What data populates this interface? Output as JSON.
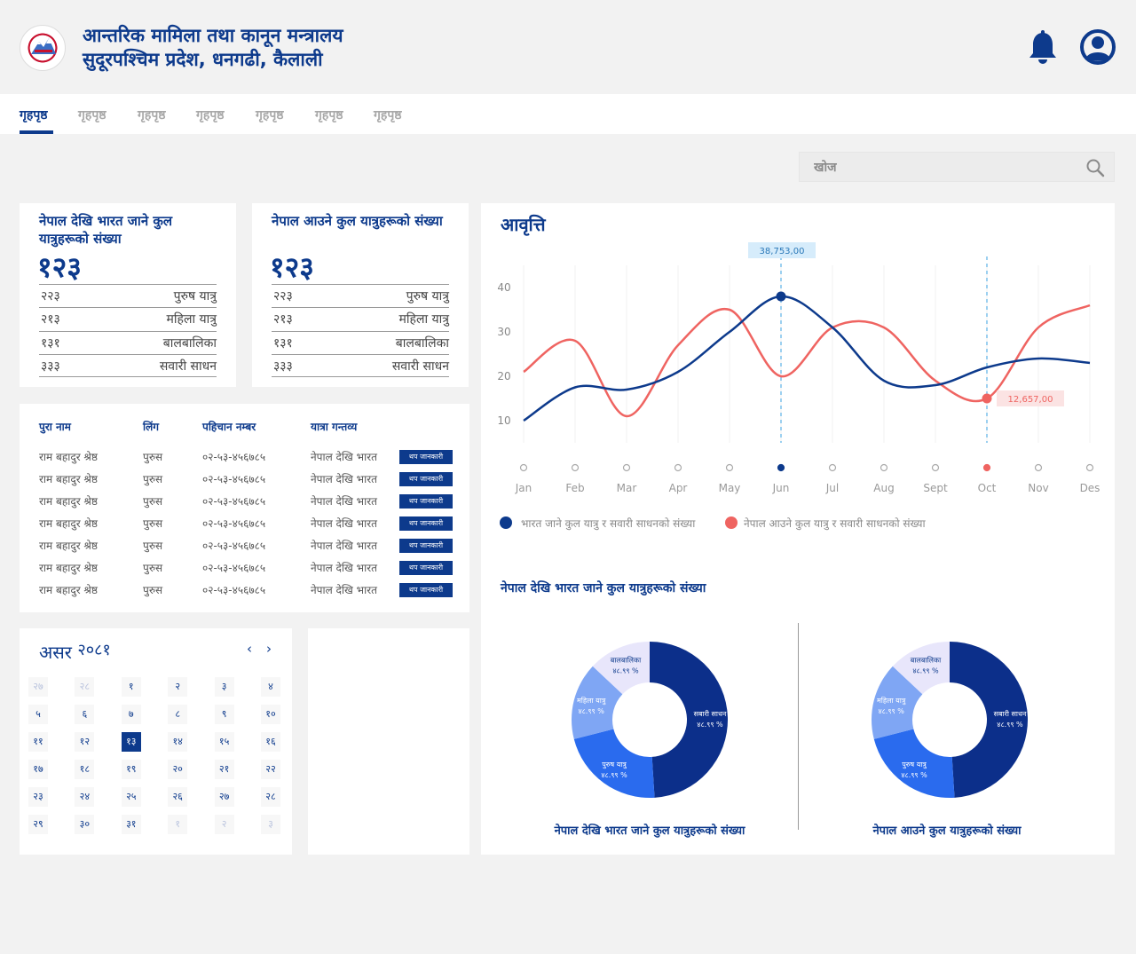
{
  "header": {
    "title_line1": "आन्तरिक मामिला तथा कानून मन्त्रालय",
    "title_line2": "सुदूरपश्चिम प्रदेश, धनगढी, कैलाली",
    "icons": [
      "bell-icon",
      "user-icon"
    ]
  },
  "nav": {
    "tabs": [
      "गृहपृष्ठ",
      "गृहपृष्ठ",
      "गृहपृष्ठ",
      "गृहपृष्ठ",
      "गृहपृष्ठ",
      "गृहपृष्ठ",
      "गृहपृष्ठ"
    ],
    "active_index": 0
  },
  "search": {
    "placeholder": "खोज"
  },
  "stat_cards": [
    {
      "title": "नेपाल देखि भारत जाने कुल यात्रुहरूको संख्या",
      "total": "१२३",
      "rows": [
        {
          "value": "२२३",
          "label": "पुरुष यात्रु"
        },
        {
          "value": "२१३",
          "label": "महिला यात्रु"
        },
        {
          "value": "१३१",
          "label": "बालबालिका"
        },
        {
          "value": "३३३",
          "label": "सवारी साधन"
        }
      ]
    },
    {
      "title": "नेपाल आउने कुल यात्रुहरूको संख्या",
      "total": "१२३",
      "rows": [
        {
          "value": "२२३",
          "label": "पुरुष यात्रु"
        },
        {
          "value": "२१३",
          "label": "महिला यात्रु"
        },
        {
          "value": "१३१",
          "label": "बालबालिका"
        },
        {
          "value": "३३३",
          "label": "सवारी साधन"
        }
      ]
    }
  ],
  "table": {
    "headers": [
      "पुरा नाम",
      "लिंग",
      "पहिचान नम्बर",
      "यात्रा गन्तव्य"
    ],
    "button_label": "थप जानकारी",
    "rows": [
      [
        "राम बहादुर श्रेष्ठ",
        "पुरुस",
        "०२-५३-४५६७८५",
        "नेपाल देखि भारत"
      ],
      [
        "राम बहादुर श्रेष्ठ",
        "पुरुस",
        "०२-५३-४५६७८५",
        "नेपाल देखि भारत"
      ],
      [
        "राम बहादुर श्रेष्ठ",
        "पुरुस",
        "०२-५३-४५६७८५",
        "नेपाल देखि भारत"
      ],
      [
        "राम बहादुर श्रेष्ठ",
        "पुरुस",
        "०२-५३-४५६७८५",
        "नेपाल देखि भारत"
      ],
      [
        "राम बहादुर श्रेष्ठ",
        "पुरुस",
        "०२-५३-४५६७८५",
        "नेपाल देखि भारत"
      ],
      [
        "राम बहादुर श्रेष्ठ",
        "पुरुस",
        "०२-५३-४५६७८५",
        "नेपाल देखि भारत"
      ],
      [
        "राम बहादुर श्रेष्ठ",
        "पुरुस",
        "०२-५३-४५६७८५",
        "नेपाल देखि भारत"
      ]
    ]
  },
  "calendar": {
    "month": "असर",
    "year": "२०८१",
    "prev": "‹",
    "next": "›",
    "selected_index": 14,
    "days": [
      {
        "d": "२७",
        "m": true
      },
      {
        "d": "२८",
        "m": true
      },
      {
        "d": "१",
        "m": false
      },
      {
        "d": "२",
        "m": false
      },
      {
        "d": "३",
        "m": false
      },
      {
        "d": "४",
        "m": false
      },
      {
        "d": "५",
        "m": false
      },
      {
        "d": "६",
        "m": false
      },
      {
        "d": "७",
        "m": false
      },
      {
        "d": "८",
        "m": false
      },
      {
        "d": "९",
        "m": false
      },
      {
        "d": "१०",
        "m": false
      },
      {
        "d": "११",
        "m": false
      },
      {
        "d": "१२",
        "m": false
      },
      {
        "d": "१३",
        "m": false
      },
      {
        "d": "१४",
        "m": false
      },
      {
        "d": "१५",
        "m": false
      },
      {
        "d": "१६",
        "m": false
      },
      {
        "d": "१७",
        "m": false
      },
      {
        "d": "१८",
        "m": false
      },
      {
        "d": "१९",
        "m": false
      },
      {
        "d": "२०",
        "m": false
      },
      {
        "d": "२१",
        "m": false
      },
      {
        "d": "२२",
        "m": false
      },
      {
        "d": "२३",
        "m": false
      },
      {
        "d": "२४",
        "m": false
      },
      {
        "d": "२५",
        "m": false
      },
      {
        "d": "२६",
        "m": false
      },
      {
        "d": "२७",
        "m": false
      },
      {
        "d": "२८",
        "m": false
      },
      {
        "d": "२९",
        "m": false
      },
      {
        "d": "३०",
        "m": false
      },
      {
        "d": "३१",
        "m": false
      },
      {
        "d": "१",
        "m": true
      },
      {
        "d": "२",
        "m": true
      },
      {
        "d": "३",
        "m": true
      }
    ]
  },
  "chart_section": {
    "title": "आवृत्ति",
    "legend": [
      "भारत जाने कुल यात्रु र सवारी साधनको संख्या",
      "नेपाल आउने कुल यात्रु र सवारी साधनको संख्या"
    ],
    "donut_section_title": "नेपाल देखि  भारत जाने कुल यात्रुहरूको संख्या",
    "donut_captions": [
      "नेपाल देखि  भारत जाने कुल यात्रुहरूको संख्या",
      "नेपाल आउने कुल यात्रुहरूको संख्या"
    ]
  },
  "colors": {
    "primary": "#0d3a8c",
    "red": "#ef6461",
    "light_blue_tag": "#d6ecfb",
    "light_red_tag": "#fbe3e3"
  },
  "chart_data": [
    {
      "type": "line",
      "x": [
        "Jan",
        "Feb",
        "Mar",
        "Apr",
        "May",
        "Jun",
        "Jul",
        "Aug",
        "Sept",
        "Oct",
        "Nov",
        "Des"
      ],
      "ylim": [
        5,
        45
      ],
      "yticks": [
        10,
        20,
        30,
        40
      ],
      "series": [
        {
          "name": "भारत जाने कुल यात्रु र सवारी साधनको संख्या",
          "color": "#0d3a8c",
          "values": [
            10,
            17.5,
            17,
            21,
            30,
            38,
            31,
            19,
            18,
            22,
            24,
            23
          ]
        },
        {
          "name": "नेपाल आउने कुल यात्रु र सवारी साधनको संख्या",
          "color": "#ef6461",
          "values": [
            21,
            28,
            11,
            27,
            35,
            20,
            31,
            31,
            19,
            15,
            31,
            36
          ]
        }
      ],
      "annotations": [
        {
          "label": "38,753,00",
          "series": 0,
          "index": 5
        },
        {
          "label": "12,657,00",
          "series": 1,
          "index": 9
        }
      ],
      "highlighted": [
        5,
        9
      ]
    },
    {
      "type": "pie",
      "labels": [
        "सबारी साधन",
        "पुरुष यात्रु",
        "महिला यात्रु",
        "बालबालिका"
      ],
      "values": [
        48.99,
        22,
        16,
        13
      ],
      "value_labels": [
        "४८.९९ %",
        "४८.९९ %",
        "४८.९९ %",
        "४८.९९ %"
      ],
      "colors": [
        "#0c2f8a",
        "#2a6bee",
        "#7fa6f4",
        "#e8e6fb"
      ]
    },
    {
      "type": "pie",
      "labels": [
        "सबारी साधन",
        "पुरुष यात्रु",
        "महिला यात्रु",
        "बालबालिका"
      ],
      "values": [
        48.99,
        22,
        16,
        13
      ],
      "value_labels": [
        "४८.९९ %",
        "४८.९९ %",
        "४८.९९ %",
        "४८.९९ %"
      ],
      "colors": [
        "#0c2f8a",
        "#2a6bee",
        "#7fa6f4",
        "#e8e6fb"
      ]
    }
  ]
}
